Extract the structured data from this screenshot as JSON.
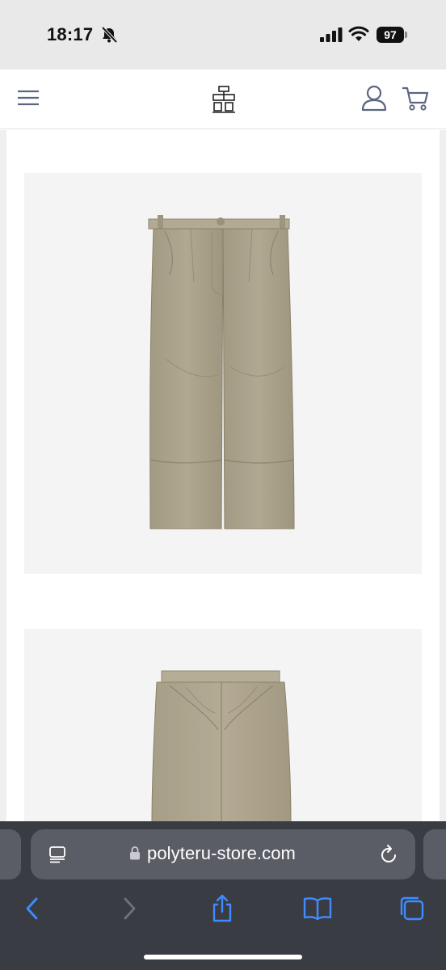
{
  "status_bar": {
    "time": "18:17",
    "battery": "97"
  },
  "site_header": {
    "icons": [
      "menu-icon",
      "logo-icon",
      "user-icon",
      "cart-icon"
    ]
  },
  "products": [
    {
      "image": "pants-front-photo",
      "color": "#a9a08a"
    },
    {
      "image": "pants-back-photo",
      "color": "#aea68f"
    }
  ],
  "browser": {
    "url": "polyteru-store.com",
    "accent": "#3f8cff",
    "icons": [
      "reader-icon",
      "lock-icon",
      "reload-icon",
      "back-icon",
      "forward-icon",
      "share-icon",
      "bookmarks-icon",
      "tabs-icon"
    ]
  }
}
